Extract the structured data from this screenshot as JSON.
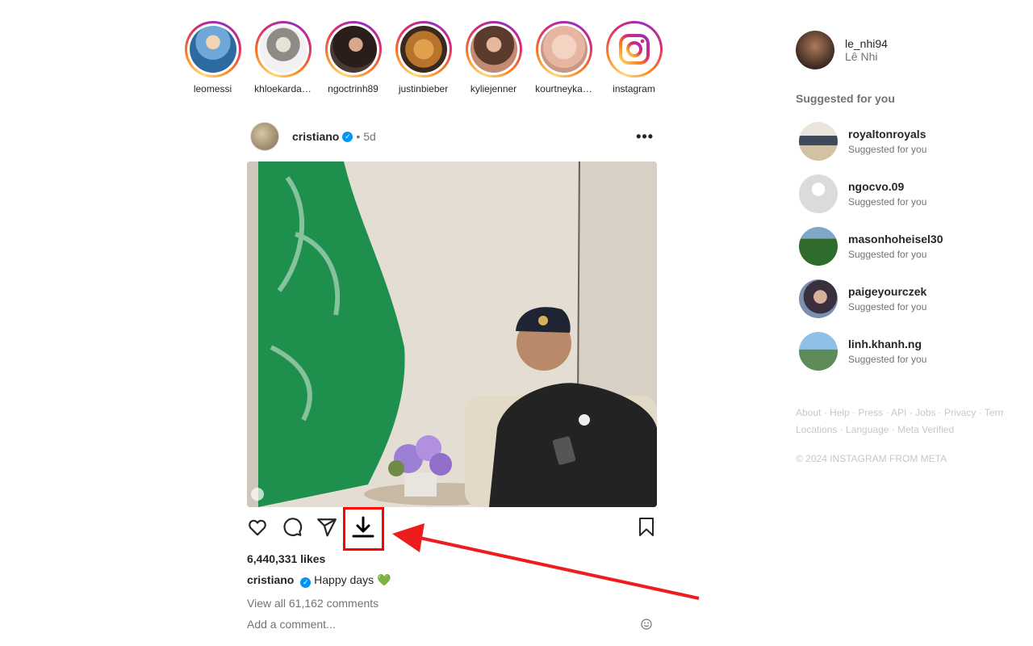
{
  "stories": [
    {
      "name": "leomessi",
      "icon": "avatar"
    },
    {
      "name": "khloekarda…",
      "icon": "avatar"
    },
    {
      "name": "ngoctrinh89",
      "icon": "avatar"
    },
    {
      "name": "justinbieber",
      "icon": "avatar"
    },
    {
      "name": "kyliejenner",
      "icon": "avatar"
    },
    {
      "name": "kourtneyka…",
      "icon": "avatar"
    },
    {
      "name": "instagram",
      "icon": "instagram-logo"
    }
  ],
  "post": {
    "user": "cristiano",
    "dot": "•",
    "time": "5d",
    "likes": "6,440,331 likes",
    "caption_user": "cristiano",
    "caption_text": "Happy days",
    "caption_emoji": "💚",
    "view_comments": "View all 61,162 comments",
    "add_comment_placeholder": "Add a comment..."
  },
  "sidebar": {
    "me": {
      "username": "le_nhi94",
      "name": "Lê Nhi"
    },
    "suggested_title": "Suggested for you",
    "suggestions": [
      {
        "username": "royaltonroyals",
        "subtitle": "Suggested for you"
      },
      {
        "username": "ngocvo.09",
        "subtitle": "Suggested for you"
      },
      {
        "username": "masonhoheisel30",
        "subtitle": "Suggested for you"
      },
      {
        "username": "paigeyourczek",
        "subtitle": "Suggested for you"
      },
      {
        "username": "linh.khanh.ng",
        "subtitle": "Suggested for you"
      }
    ],
    "footer_line1": "About · Help · Press · API · Jobs · Privacy · Terms",
    "footer_line2": "Locations · Language · Meta Verified",
    "copyright": "© 2024 INSTAGRAM FROM META"
  },
  "colors": {
    "verified": "#0095f6",
    "highlight": "#ff0000",
    "secondary_text": "#737373"
  }
}
